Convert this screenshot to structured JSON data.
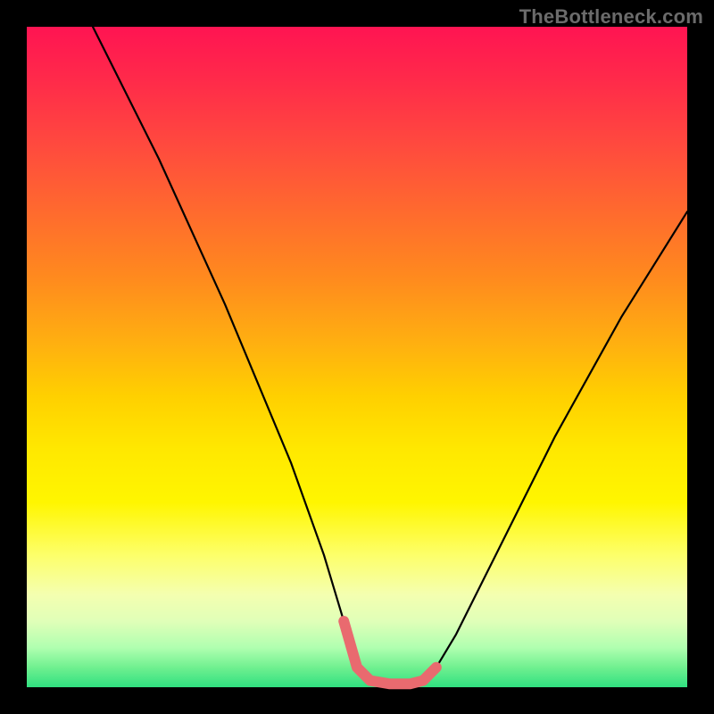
{
  "watermark": "TheBottleneck.com",
  "chart_data": {
    "type": "line",
    "title": "",
    "xlabel": "",
    "ylabel": "",
    "xlim": [
      0,
      100
    ],
    "ylim": [
      0,
      100
    ],
    "series": [
      {
        "name": "curve",
        "color": "#000000",
        "x": [
          10,
          15,
          20,
          25,
          30,
          35,
          40,
          45,
          48,
          50,
          52,
          55,
          58,
          60,
          62,
          65,
          70,
          75,
          80,
          85,
          90,
          95,
          100
        ],
        "y": [
          100,
          90,
          80,
          69,
          58,
          46,
          34,
          20,
          10,
          3,
          1,
          0.5,
          0.5,
          1,
          3,
          8,
          18,
          28,
          38,
          47,
          56,
          64,
          72
        ]
      },
      {
        "name": "highlight-band",
        "color": "#e96a6f",
        "x": [
          48,
          50,
          52,
          55,
          58,
          60,
          62
        ],
        "y": [
          10,
          3,
          1,
          0.5,
          0.5,
          1,
          3
        ]
      }
    ],
    "grid": false,
    "legend": false,
    "background_gradient": {
      "top": "#ff1452",
      "mid": "#ffe800",
      "bottom": "#30e080"
    }
  }
}
